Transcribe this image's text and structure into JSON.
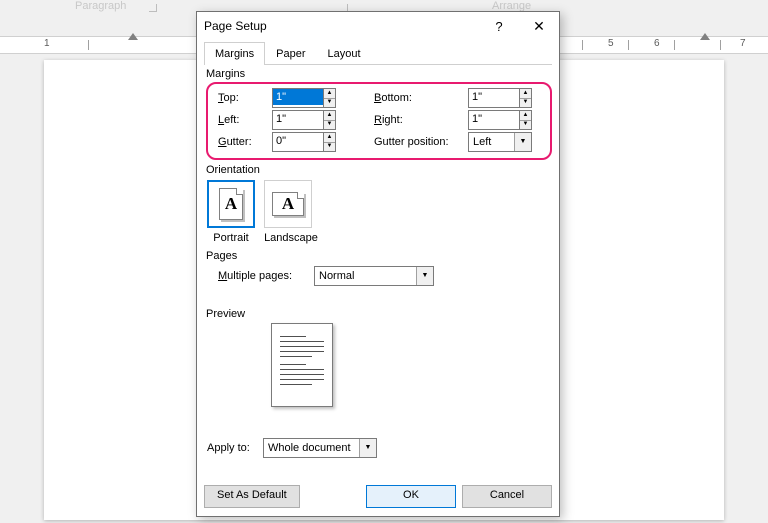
{
  "bg": {
    "paragraph": "Paragraph",
    "arrange": "Arrange"
  },
  "ruler": {
    "n1": "1",
    "n5": "5",
    "n6": "6",
    "n7": "7"
  },
  "dialog": {
    "title": "Page Setup",
    "tabs": {
      "margins": "Margins",
      "paper": "Paper",
      "layout": "Layout"
    },
    "margins": {
      "group": "Margins",
      "top_label": "Top:",
      "top_value": "1\"",
      "bottom_label": "Bottom:",
      "bottom_value": "1\"",
      "left_label": "Left:",
      "left_value": "1\"",
      "right_label": "Right:",
      "right_value": "1\"",
      "gutter_label": "Gutter:",
      "gutter_value": "0\"",
      "gutterpos_label": "Gutter position:",
      "gutterpos_value": "Left"
    },
    "orientation": {
      "group": "Orientation",
      "portrait": "Portrait",
      "landscape": "Landscape",
      "glyph": "A"
    },
    "pages": {
      "group": "Pages",
      "multiple_label": "Multiple pages:",
      "multiple_value": "Normal"
    },
    "preview": {
      "group": "Preview"
    },
    "applyto": {
      "label": "Apply to:",
      "value": "Whole document"
    },
    "buttons": {
      "default": "Set As Default",
      "ok": "OK",
      "cancel": "Cancel"
    }
  }
}
